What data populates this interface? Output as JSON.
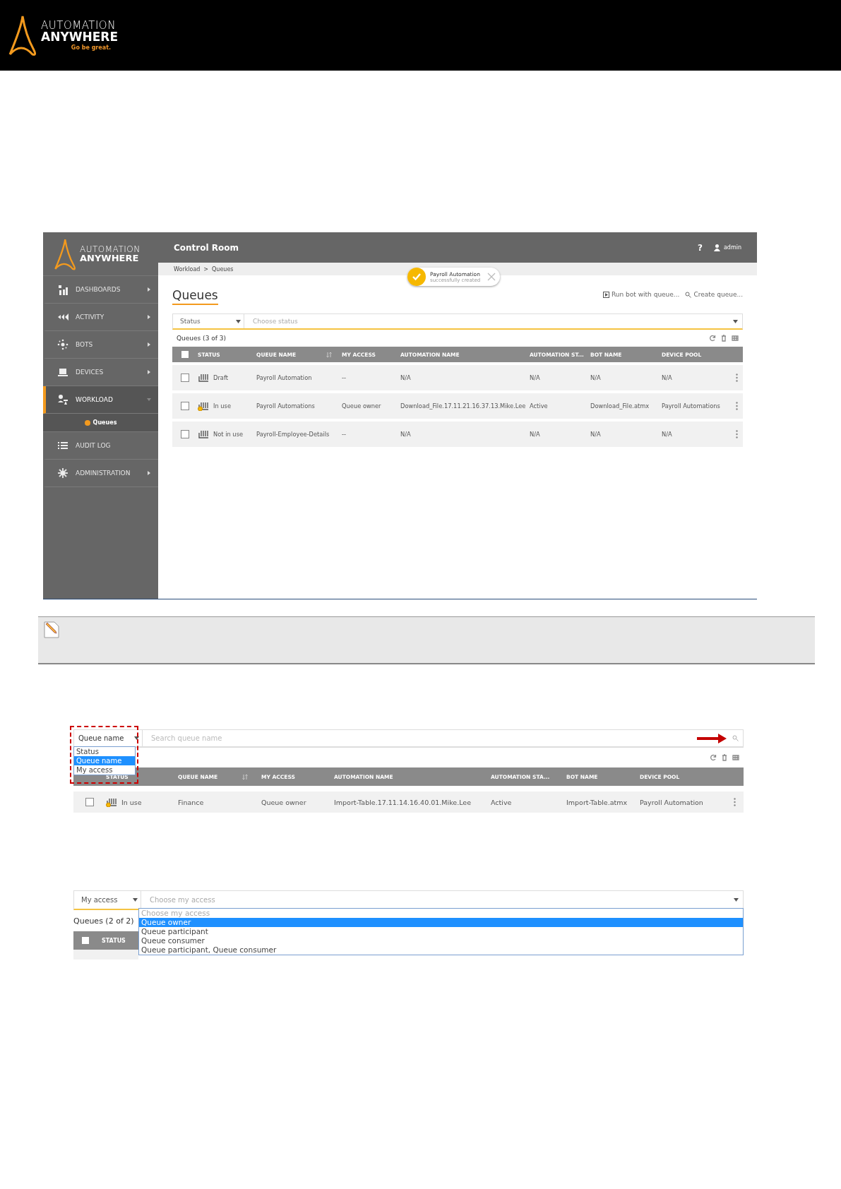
{
  "doc_header": {
    "brand_top": "AUTOMATION",
    "brand_bottom": "ANYWHERE",
    "tagline": "Go be great."
  },
  "control_room": {
    "brand_top": "AUTOMATION",
    "brand_bottom": "ANYWHERE",
    "app_title": "Control Room",
    "help": "?",
    "user": "admin",
    "nav": [
      {
        "label": "DASHBOARDS",
        "selected": false,
        "expanded": false
      },
      {
        "label": "ACTIVITY",
        "selected": false,
        "expanded": false
      },
      {
        "label": "BOTS",
        "selected": false,
        "expanded": false
      },
      {
        "label": "DEVICES",
        "selected": false,
        "expanded": false
      },
      {
        "label": "WORKLOAD",
        "selected": true,
        "expanded": true,
        "children": [
          {
            "label": "Queues",
            "selected": true
          }
        ]
      },
      {
        "label": "AUDIT LOG",
        "selected": false
      },
      {
        "label": "ADMINISTRATION",
        "selected": false,
        "expanded": false
      }
    ],
    "breadcrumb": [
      "Workload",
      "Queues"
    ],
    "breadcrumb_separator": ">",
    "toast": {
      "title": "Payroll Automation",
      "message": "successfully created"
    },
    "page_title": "Queues",
    "actions": [
      "Run bot with queue...",
      "Create queue..."
    ],
    "filter": {
      "field": "Status",
      "placeholder": "Choose status"
    },
    "count": "Queues (3 of 3)",
    "all_checked": false,
    "columns": [
      "STATUS",
      "QUEUE NAME",
      "MY ACCESS",
      "AUTOMATION NAME",
      "AUTOMATION ST...",
      "BOT NAME",
      "DEVICE POOL"
    ],
    "rows": [
      {
        "checked": false,
        "busy": false,
        "cells": [
          "Draft",
          "Payroll Automation",
          "--",
          "N/A",
          "N/A",
          "N/A",
          "N/A"
        ]
      },
      {
        "checked": false,
        "busy": true,
        "cells": [
          "In use",
          "Payroll Automations",
          "Queue owner",
          "Download_File.17.11.21.16.37.13.Mike.Lee",
          "Active",
          "Download_File.atmx",
          "Payroll Automations"
        ]
      },
      {
        "checked": false,
        "busy": false,
        "cells": [
          "Not in use",
          "Payroll-Employee-Details",
          "--",
          "N/A",
          "N/A",
          "N/A",
          "N/A"
        ]
      }
    ]
  },
  "search_example": {
    "filter_field": "Queue name",
    "placeholder": "Search queue name",
    "options": [
      {
        "label": "Status",
        "selected": false
      },
      {
        "label": "Queue name",
        "selected": true
      },
      {
        "label": "My access",
        "selected": false
      }
    ],
    "columns": [
      "STATUS",
      "QUEUE NAME",
      "MY ACCESS",
      "AUTOMATION NAME",
      "AUTOMATION STA...",
      "BOT NAME",
      "DEVICE POOL"
    ],
    "rows": [
      {
        "checked": false,
        "busy": true,
        "cells": [
          "In use",
          "Finance",
          "Queue owner",
          "Import-Table.17.11.14.16.40.01.Mike.Lee",
          "Active",
          "Import-Table.atmx",
          "Payroll Automation"
        ]
      }
    ]
  },
  "access_example": {
    "filter_field": "My access",
    "placeholder": "Choose my access",
    "count": "Queues (2 of 2)",
    "all_checked": false,
    "column": "STATUS",
    "options": [
      {
        "label": "Choose my access",
        "selected": false
      },
      {
        "label": "Queue owner",
        "selected": true
      },
      {
        "label": "Queue participant",
        "selected": false
      },
      {
        "label": "Queue consumer",
        "selected": false
      },
      {
        "label": "Queue participant, Queue consumer",
        "selected": false
      }
    ]
  }
}
